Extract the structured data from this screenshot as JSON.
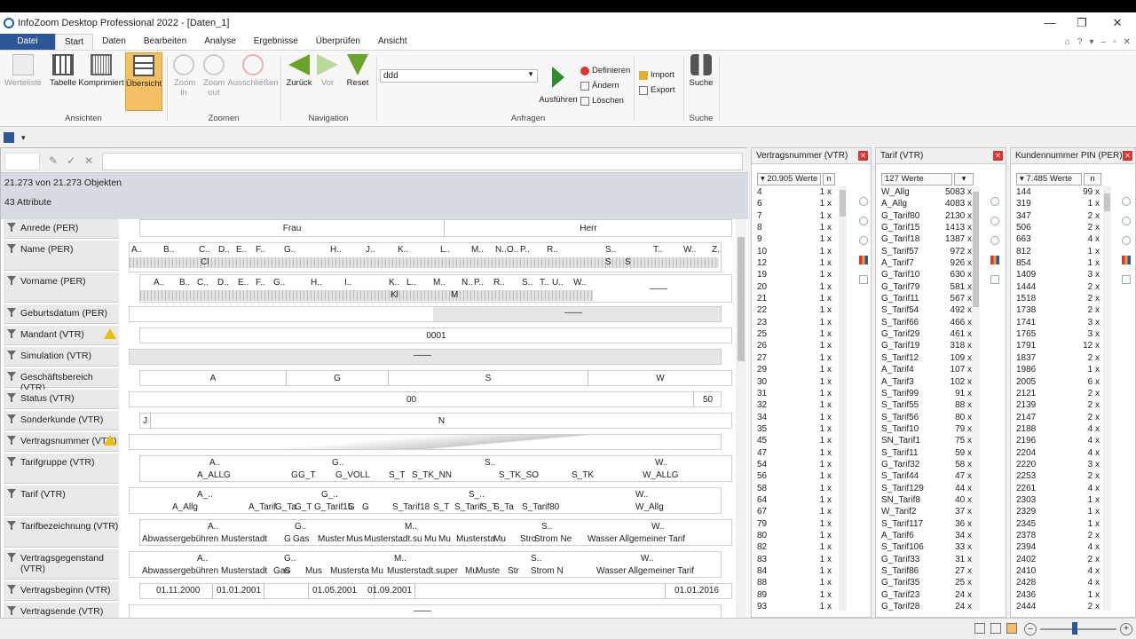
{
  "window": {
    "title": "InfoZoom Desktop Professional 2022 - [Daten_1]",
    "min": "—",
    "max": "❐",
    "close": "✕"
  },
  "menu": {
    "file": "Datei",
    "tabs": [
      "Start",
      "Daten",
      "Bearbeiten",
      "Analyse",
      "Ergebnisse",
      "Überprüfen",
      "Ansicht"
    ],
    "right": [
      "⌂",
      "?",
      "▾",
      "–",
      "▫",
      "✕"
    ]
  },
  "ribbon": {
    "ansichten": {
      "label": "Ansichten",
      "buttons": [
        "Werteliste",
        "Tabelle",
        "Komprimiert",
        "Übersicht"
      ]
    },
    "zoomen": {
      "label": "Zoomen",
      "buttons": [
        "Zoom in",
        "Zoom out",
        "Ausschließen"
      ]
    },
    "navigation": {
      "label": "Navigation",
      "buttons": [
        "Zurück",
        "Vor",
        "Reset"
      ]
    },
    "anfragen": {
      "label": "Anfragen",
      "query_value": "ddd",
      "run": "Ausführen",
      "define": "Definieren",
      "change": "Ändern",
      "delete": "Löschen"
    },
    "importexport": {
      "import": "Import",
      "export": "Export"
    },
    "suche": {
      "label": "Suche",
      "button": "Suche"
    }
  },
  "main": {
    "count_text": "21.273 von 21.273 Objekten",
    "attr_text": "43 Attribute",
    "attributes": [
      "Anrede (PER)",
      "Name (PER)",
      "Vorname (PER)",
      "Geburtsdatum (PER)",
      "Mandant (VTR)",
      "Simulation (VTR)",
      "Geschäftsbereich (VTR)",
      "Status (VTR)",
      "Sonderkunde (VTR)",
      "Vertragsnummer (VTR)",
      "Tarifgruppe (VTR)",
      "Tarif (VTR)",
      "Tarifbezeichnung (VTR)",
      "Vertragsgegenstand (VTR)",
      "Vertragsbeginn (VTR)",
      "Vertragsende (VTR)"
    ],
    "anrede": [
      "Frau",
      "Herr"
    ],
    "name_letters": [
      "A..",
      "B..",
      "C..",
      "D..",
      "E..",
      "F..",
      "G..",
      "H..",
      "J..",
      "K..",
      "L..",
      "M..",
      "N..",
      "O..",
      "P..",
      "R..",
      "S..",
      "T..",
      "W..",
      "Z.."
    ],
    "name_sub": [
      "Cl",
      "S",
      "S"
    ],
    "vorname_letters": [
      "A..",
      "B..",
      "C..",
      "D..",
      "E..",
      "F..",
      "G..",
      "H..",
      "I..",
      "K..",
      "L..",
      "M..",
      "N..",
      "P..",
      "R..",
      "S..",
      "T..",
      "U..",
      "W.."
    ],
    "vorname_sub": [
      "Kl",
      "M"
    ],
    "vorname_dash": "——",
    "geburtsdatum_dash": "——",
    "mandant": "0001",
    "simulation_dash": "——",
    "geschaeftsbereich": [
      "A",
      "G",
      "S",
      "W"
    ],
    "status": [
      "00",
      "50"
    ],
    "sonderkunde": [
      "J",
      "N"
    ],
    "tarifgruppe": {
      "top": [
        "A..",
        "G..",
        "S..",
        "W.."
      ],
      "bottom": [
        "A_ALLG",
        "G",
        "G_T",
        "G_VOLL",
        "S_T",
        "S_TK_NN",
        "S_TK_SO",
        "S_TK",
        "W_ALLG"
      ]
    },
    "tarif": {
      "top": [
        "A_..",
        "G_..",
        "S_..",
        "W.."
      ],
      "bottom": [
        "A_Allg",
        "A_Tarif",
        "G_Ta",
        "G_T",
        "G_Tarif15",
        "G",
        "G",
        "S_Tarif18",
        "S_T",
        "S_Tarif",
        "S_T",
        "S_Ta",
        "S_Tarif80",
        "W_Allg"
      ]
    },
    "tarifbez": {
      "top": [
        "A..",
        "G..",
        "M..",
        "S..",
        "W.."
      ],
      "bottom": [
        "Abwassergebühren Musterstadt",
        "G",
        "Gas",
        "Muster",
        "Mus",
        "Musterstadt.su",
        "Mu",
        "Mu",
        "Mustersta",
        "Mu",
        "Stro",
        "Strom Ne",
        "Wasser Allgemeiner Tarif"
      ]
    },
    "vertragsgeg": {
      "top": [
        "A..",
        "G..",
        "M..",
        "S..",
        "W.."
      ],
      "bottom": [
        "Abwassergebühren Musterstadt",
        "Gas",
        "G",
        "Mus",
        "Mustersta",
        "Mu",
        "Musterstadt.super",
        "Mu",
        "Muste",
        "Str",
        "Strom N",
        "Wasser Allgemeiner Tarif"
      ]
    },
    "vertragsbeginn": [
      "01.11.2000",
      "01.01.2001",
      "01.05.2001",
      "01.09.2001",
      "01.01.2016"
    ],
    "vertragsende_dash": "——"
  },
  "panels": [
    {
      "title": "Vertragsnummer (VTR)",
      "count": "▾ 20.905 Werte",
      "n": "n",
      "rows": [
        [
          "4",
          "1 x"
        ],
        [
          "6",
          "1 x"
        ],
        [
          "7",
          "1 x"
        ],
        [
          "8",
          "1 x"
        ],
        [
          "9",
          "1 x"
        ],
        [
          "10",
          "1 x"
        ],
        [
          "12",
          "1 x"
        ],
        [
          "19",
          "1 x"
        ],
        [
          "20",
          "1 x"
        ],
        [
          "21",
          "1 x"
        ],
        [
          "22",
          "1 x"
        ],
        [
          "23",
          "1 x"
        ],
        [
          "25",
          "1 x"
        ],
        [
          "26",
          "1 x"
        ],
        [
          "27",
          "1 x"
        ],
        [
          "29",
          "1 x"
        ],
        [
          "30",
          "1 x"
        ],
        [
          "31",
          "1 x"
        ],
        [
          "32",
          "1 x"
        ],
        [
          "34",
          "1 x"
        ],
        [
          "35",
          "1 x"
        ],
        [
          "45",
          "1 x"
        ],
        [
          "47",
          "1 x"
        ],
        [
          "54",
          "1 x"
        ],
        [
          "56",
          "1 x"
        ],
        [
          "58",
          "1 x"
        ],
        [
          "64",
          "1 x"
        ],
        [
          "67",
          "1 x"
        ],
        [
          "79",
          "1 x"
        ],
        [
          "80",
          "1 x"
        ],
        [
          "82",
          "1 x"
        ],
        [
          "83",
          "1 x"
        ],
        [
          "84",
          "1 x"
        ],
        [
          "88",
          "1 x"
        ],
        [
          "89",
          "1 x"
        ],
        [
          "93",
          "1 x"
        ]
      ]
    },
    {
      "title": "Tarif (VTR)",
      "count": "127 Werte",
      "n": "▾",
      "rows": [
        [
          "W_Allg",
          "5083 x"
        ],
        [
          "A_Allg",
          "4083 x"
        ],
        [
          "G_Tarif80",
          "2130 x"
        ],
        [
          "G_Tarif15",
          "1413 x"
        ],
        [
          "G_Tarif18",
          "1387 x"
        ],
        [
          "S_Tarif57",
          "972 x"
        ],
        [
          "A_Tarif7",
          "926 x"
        ],
        [
          "G_Tarif10",
          "630 x"
        ],
        [
          "G_Tarif79",
          "581 x"
        ],
        [
          "G_Tarif11",
          "567 x"
        ],
        [
          "S_Tarif54",
          "492 x"
        ],
        [
          "S_Tarif66",
          "466 x"
        ],
        [
          "G_Tarif29",
          "461 x"
        ],
        [
          "G_Tarif19",
          "318 x"
        ],
        [
          "S_Tarif12",
          "109 x"
        ],
        [
          "A_Tarif4",
          "107 x"
        ],
        [
          "A_Tarif3",
          "102 x"
        ],
        [
          "S_Tarif99",
          "91 x"
        ],
        [
          "S_Tarif55",
          "88 x"
        ],
        [
          "S_Tarif56",
          "80 x"
        ],
        [
          "S_Tarif10",
          "79 x"
        ],
        [
          "SN_Tarif1",
          "75 x"
        ],
        [
          "S_Tarif11",
          "59 x"
        ],
        [
          "G_Tarif32",
          "58 x"
        ],
        [
          "S_Tarif44",
          "47 x"
        ],
        [
          "S_Tarif129",
          "44 x"
        ],
        [
          "SN_Tarif8",
          "40 x"
        ],
        [
          "W_Tarif2",
          "37 x"
        ],
        [
          "S_Tarif117",
          "36 x"
        ],
        [
          "A_Tarif6",
          "34 x"
        ],
        [
          "S_Tarif106",
          "33 x"
        ],
        [
          "G_Tarif33",
          "31 x"
        ],
        [
          "S_Tarif86",
          "27 x"
        ],
        [
          "G_Tarif35",
          "25 x"
        ],
        [
          "G_Tarif23",
          "24 x"
        ],
        [
          "G_Tarif28",
          "24 x"
        ]
      ]
    },
    {
      "title": "Kundennummer PIN (PER)",
      "count": "▾ 7.485 Werte",
      "n": "n",
      "rows": [
        [
          "144",
          "99 x"
        ],
        [
          "319",
          "1 x"
        ],
        [
          "347",
          "2 x"
        ],
        [
          "506",
          "2 x"
        ],
        [
          "663",
          "4 x"
        ],
        [
          "812",
          "1 x"
        ],
        [
          "854",
          "1 x"
        ],
        [
          "1409",
          "3 x"
        ],
        [
          "1444",
          "2 x"
        ],
        [
          "1518",
          "2 x"
        ],
        [
          "1738",
          "2 x"
        ],
        [
          "1741",
          "3 x"
        ],
        [
          "1765",
          "3 x"
        ],
        [
          "1791",
          "12 x"
        ],
        [
          "1837",
          "2 x"
        ],
        [
          "1986",
          "1 x"
        ],
        [
          "2005",
          "6 x"
        ],
        [
          "2121",
          "2 x"
        ],
        [
          "2139",
          "2 x"
        ],
        [
          "2147",
          "2 x"
        ],
        [
          "2188",
          "4 x"
        ],
        [
          "2196",
          "4 x"
        ],
        [
          "2204",
          "4 x"
        ],
        [
          "2220",
          "3 x"
        ],
        [
          "2253",
          "2 x"
        ],
        [
          "2261",
          "4 x"
        ],
        [
          "2303",
          "1 x"
        ],
        [
          "2329",
          "1 x"
        ],
        [
          "2345",
          "1 x"
        ],
        [
          "2378",
          "2 x"
        ],
        [
          "2394",
          "4 x"
        ],
        [
          "2402",
          "2 x"
        ],
        [
          "2410",
          "4 x"
        ],
        [
          "2428",
          "4 x"
        ],
        [
          "2436",
          "1 x"
        ],
        [
          "2444",
          "2 x"
        ]
      ]
    }
  ],
  "colors": {
    "accent": "#2b5797",
    "arrow_green": "#6aa32a",
    "highlight": "#f5c064",
    "warning": "#e8c000",
    "close_red": "#d33"
  }
}
